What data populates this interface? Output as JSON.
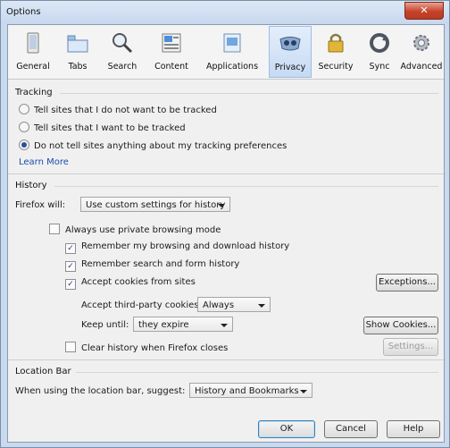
{
  "window": {
    "title": "Options",
    "close_glyph": "✕"
  },
  "toolbar": {
    "panes": [
      {
        "label": "General",
        "icon": "general-icon"
      },
      {
        "label": "Tabs",
        "icon": "tabs-icon"
      },
      {
        "label": "Search",
        "icon": "search-icon"
      },
      {
        "label": "Content",
        "icon": "content-icon"
      },
      {
        "label": "Applications",
        "icon": "applications-icon"
      },
      {
        "label": "Privacy",
        "icon": "privacy-icon",
        "selected": true
      },
      {
        "label": "Security",
        "icon": "security-icon"
      },
      {
        "label": "Sync",
        "icon": "sync-icon"
      },
      {
        "label": "Advanced",
        "icon": "advanced-icon"
      }
    ]
  },
  "tracking": {
    "heading": "Tracking",
    "options": [
      "Tell sites that I do not want to be tracked",
      "Tell sites that I want to be tracked",
      "Do not tell sites anything about my tracking preferences"
    ],
    "selected_index": 2,
    "learn_more": "Learn More"
  },
  "history": {
    "heading": "History",
    "firefox_will_label": "Firefox will:",
    "firefox_will_value": "Use custom settings for history",
    "private_mode": "Always use private browsing mode",
    "remember_browsing": "Remember my browsing and download history",
    "remember_search": "Remember search and form history",
    "accept_cookies": "Accept cookies from sites",
    "exceptions_button": "Exceptions...",
    "third_party_label": "Accept third-party cookies:",
    "third_party_value": "Always",
    "keep_until_label": "Keep until:",
    "keep_until_value": "they expire",
    "show_cookies_button": "Show Cookies...",
    "clear_history": "Clear history when Firefox closes",
    "settings_button": "Settings...",
    "check_glyph": "✓"
  },
  "location_bar": {
    "heading": "Location Bar",
    "suggest_label": "When using the location bar, suggest:",
    "suggest_value": "History and Bookmarks"
  },
  "footer": {
    "ok": "OK",
    "cancel": "Cancel",
    "help": "Help"
  }
}
